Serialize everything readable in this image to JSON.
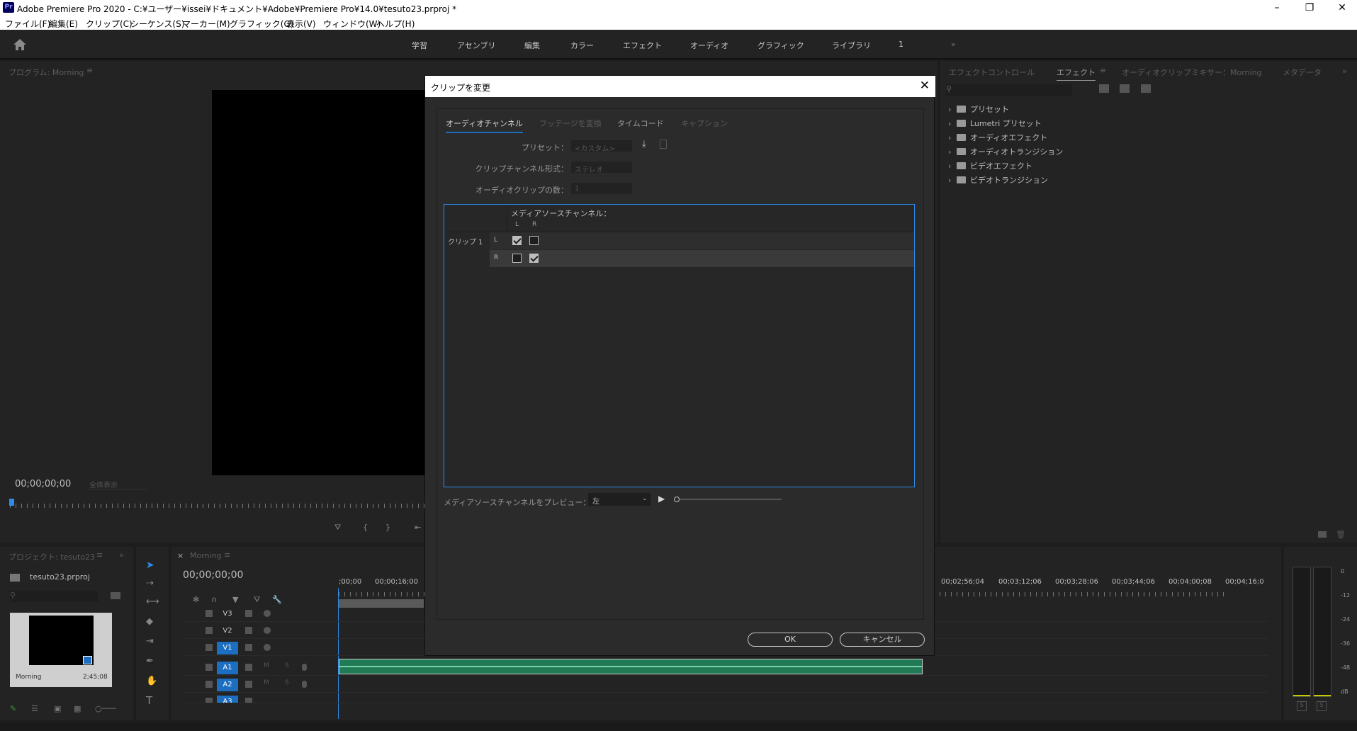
{
  "window": {
    "title": "Adobe Premiere Pro 2020 - C:¥ユーザー¥issei¥ドキュメント¥Adobe¥Premiere Pro¥14.0¥tesuto23.prproj *",
    "app_icon": "Pr"
  },
  "menu": [
    "ファイル(F)",
    "編集(E)",
    "クリップ(C)",
    "シーケンス(S)",
    "マーカー(M)",
    "グラフィック(G)",
    "表示(V)",
    "ウィンドウ(W)",
    "ヘルプ(H)"
  ],
  "workspaces": [
    "学習",
    "アセンブリ",
    "編集",
    "カラー",
    "エフェクト",
    "オーディオ",
    "グラフィック",
    "ライブラリ",
    "1"
  ],
  "program_monitor": {
    "title": "プログラム: Morning",
    "timecode": "00;00;00;00",
    "fit": "全体表示"
  },
  "right_panel": {
    "tabs": [
      "エフェクトコントロール",
      "エフェクト",
      "オーディオクリップミキサー：Morning",
      "メタデータ"
    ],
    "tree": [
      "プリセット",
      "Lumetri プリセット",
      "オーディオエフェクト",
      "オーディオトランジション",
      "ビデオエフェクト",
      "ビデオトランジション"
    ]
  },
  "project": {
    "title": "プロジェクト: tesuto23",
    "file": "tesuto23.prproj",
    "clip_name": "Morning",
    "clip_duration": "2;45;08"
  },
  "timeline": {
    "title": "Morning",
    "timecode": "00;00;00;00",
    "ruler_left": [
      ";00;00",
      "00;00;16;00"
    ],
    "ruler_right": [
      "00;02;56;04",
      "00;03;12;06",
      "00;03;28;06",
      "00;03;44;06",
      "00;04;00;08",
      "00;04;16;0"
    ],
    "video_tracks": [
      "V3",
      "V2",
      "V1"
    ],
    "audio_tracks": [
      "A1",
      "A2",
      "A3"
    ],
    "track_m": "M",
    "track_s": "S",
    "vu_scale": [
      "0",
      "-12",
      "-24",
      "-36",
      "-48",
      "dB"
    ],
    "vu_solo": [
      "S",
      "S"
    ]
  },
  "dialog": {
    "title": "クリップを変更",
    "tabs": [
      "オーディオチャンネル",
      "フッテージを変換",
      "タイムコード",
      "キャプション"
    ],
    "preset_label": "プリセット：",
    "preset_value": "<カスタム>",
    "channel_format_label": "クリップチャンネル形式：",
    "channel_format_value": "ステレオ",
    "clip_count_label": "オーディオクリップの数：",
    "clip_count_value": "1",
    "matrix_header": "メディアソースチャンネル：",
    "matrix_cols": [
      "L",
      "R"
    ],
    "clip_label": "クリップ 1",
    "rows": [
      {
        "ch": "L",
        "L": true,
        "R": false
      },
      {
        "ch": "R",
        "L": false,
        "R": true
      }
    ],
    "preview_label": "メディアソースチャンネルをプレビュー：",
    "preview_value": "左",
    "ok": "OK",
    "cancel": "キャンセル"
  },
  "colors": {
    "accent": "#1b6ec0",
    "audio_clip": "#1f7a55"
  }
}
